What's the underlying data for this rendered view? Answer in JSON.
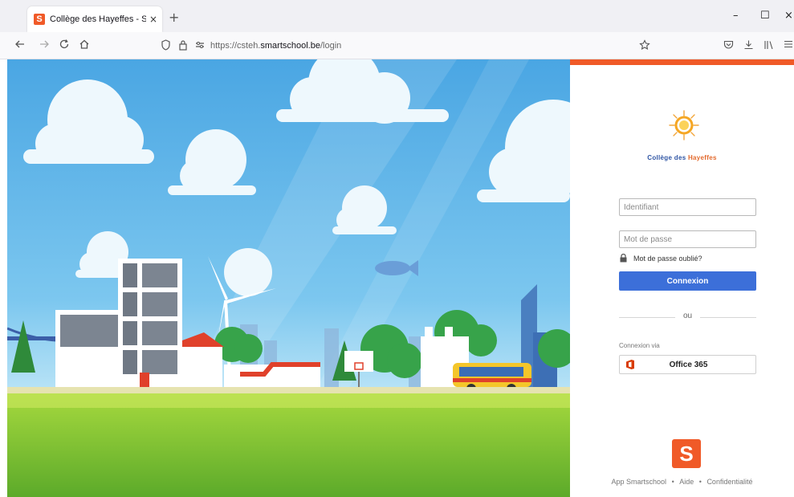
{
  "browser": {
    "tab_title": "Collège des Hayeffes - Smartsc",
    "tab_close": "×",
    "new_tab": "+",
    "url_prefix": "https://csteh.",
    "url_domain": "smartschool.be",
    "url_path": "/login",
    "window_controls": {
      "minimize": "–",
      "maximize": "☐",
      "close": "×"
    }
  },
  "school": {
    "name_prefix": "Collège des ",
    "name_accent": "Hayeffes"
  },
  "login": {
    "username_placeholder": "Identifiant",
    "password_placeholder": "Mot de passe",
    "forgot_password": "Mot de passe oublié?",
    "submit_label": "Connexion",
    "or_label": "ou",
    "via_label": "Connexion via",
    "office365_label": "Office 365"
  },
  "branding": {
    "logo_letter": "S"
  },
  "footer": {
    "links": [
      "App Smartschool",
      "Aide",
      "Confidentialité"
    ],
    "separator": "•"
  },
  "colors": {
    "accent_orange": "#f05a28",
    "primary_blue": "#3c6fd9",
    "school_blue": "#2f55a4",
    "school_orange": "#e36a2d",
    "office_red": "#d83b01"
  },
  "icons": {
    "back": "arrow-left-icon",
    "forward": "arrow-right-icon",
    "reload": "reload-icon",
    "home": "home-icon",
    "shield": "shield-icon",
    "lock": "lock-icon",
    "permissions": "permissions-icon",
    "bookmark": "star-icon",
    "pocket": "pocket-icon",
    "download": "download-icon",
    "library": "library-icon",
    "menu": "menu-icon"
  }
}
